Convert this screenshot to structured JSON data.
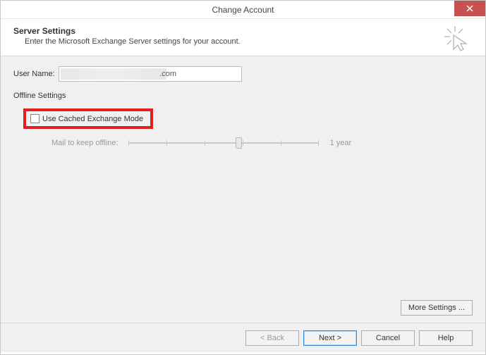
{
  "window": {
    "title": "Change Account"
  },
  "header": {
    "title": "Server Settings",
    "subtitle": "Enter the Microsoft Exchange Server settings for your account."
  },
  "form": {
    "username_label": "User Name:",
    "username_value": ".com",
    "offline_section_label": "Offline Settings",
    "cached_mode_label": "Use Cached Exchange Mode",
    "cached_mode_checked": false,
    "slider_label": "Mail to keep offline:",
    "slider_value_label": "1 year"
  },
  "buttons": {
    "more_settings": "More Settings ...",
    "back": "< Back",
    "next": "Next >",
    "cancel": "Cancel",
    "help": "Help"
  }
}
